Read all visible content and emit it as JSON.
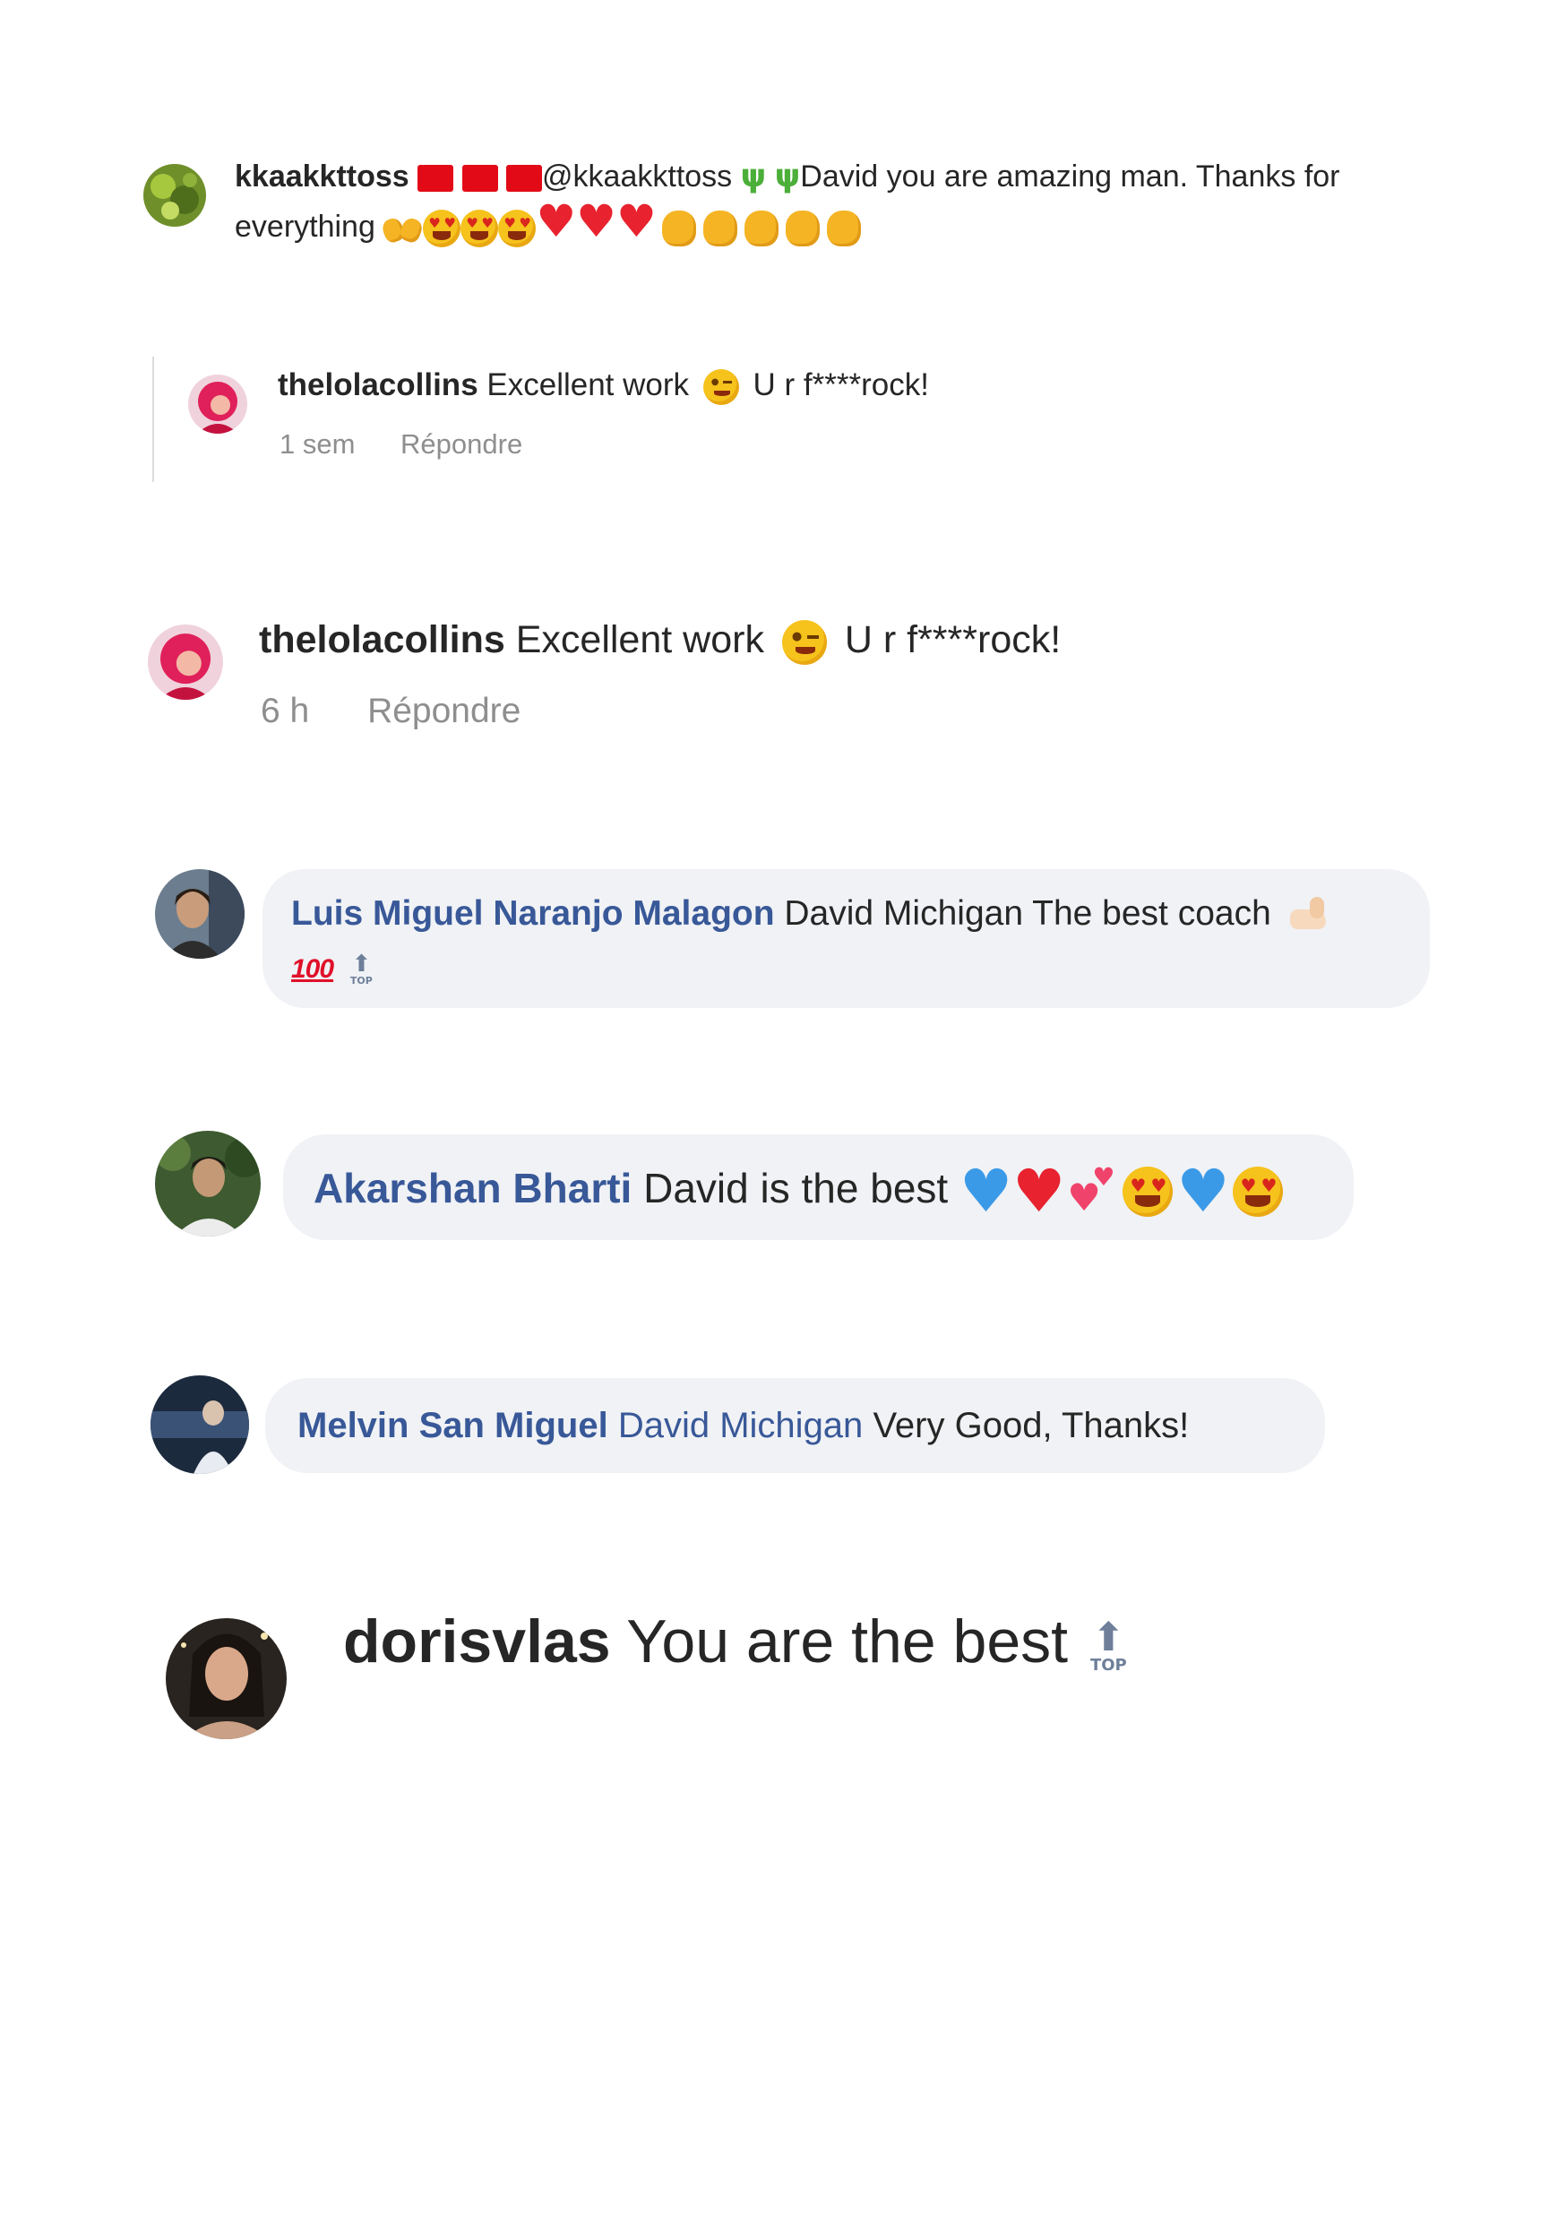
{
  "comments": [
    {
      "username": "kkaakkttoss",
      "mention": "@kkaakkttoss",
      "text_line1": "David you are amazing man. Thanks for",
      "text_line2": "everything",
      "flags": [
        "flag-tr",
        "flag-tr",
        "flag-tr"
      ],
      "emojis_line1": [
        "cactus",
        "cactus"
      ],
      "emojis_line2": [
        "raising-hands",
        "heart-eyes",
        "heart-eyes",
        "heart-eyes",
        "red-heart",
        "red-heart",
        "red-heart",
        "clap",
        "clap",
        "clap",
        "clap",
        "clap"
      ]
    },
    {
      "username": "thelolacollins",
      "text_before": "Excellent work",
      "emoji": "winking-face",
      "text_after": "U r f****rock!",
      "time": "1 sem",
      "reply": "Répondre"
    },
    {
      "username": "thelolacollins",
      "text_before": "Excellent work",
      "emoji": "winking-face",
      "text_after": "U r f****rock!",
      "time": "6 h",
      "reply": "Répondre"
    },
    {
      "name": "Luis Miguel Naranjo Malagon",
      "text": "David Michigan The best coach",
      "emojis": [
        "flexed-biceps",
        "hundred-points",
        "top-arrow"
      ],
      "top_label": "TOP"
    },
    {
      "name": "Akarshan Bharti",
      "text": "David is the best",
      "emojis": [
        "blue-heart",
        "red-heart",
        "two-hearts",
        "heart-eyes",
        "blue-heart",
        "heart-eyes"
      ]
    },
    {
      "name": "Melvin San Miguel",
      "mention": "David Michigan",
      "text": "Very Good, Thanks!"
    },
    {
      "username": "dorisvlas",
      "text": "You are the best",
      "emoji": "top-arrow",
      "top_label": "TOP"
    }
  ],
  "glyphs": {
    "hundred": "100",
    "heart": "♥",
    "cactus": "ψ",
    "arrow": "⬆",
    "raise": "🙌"
  },
  "colors": {
    "fb_name": "#385898",
    "meta": "#8e8e8e",
    "bubble": "#f0f2f5"
  }
}
